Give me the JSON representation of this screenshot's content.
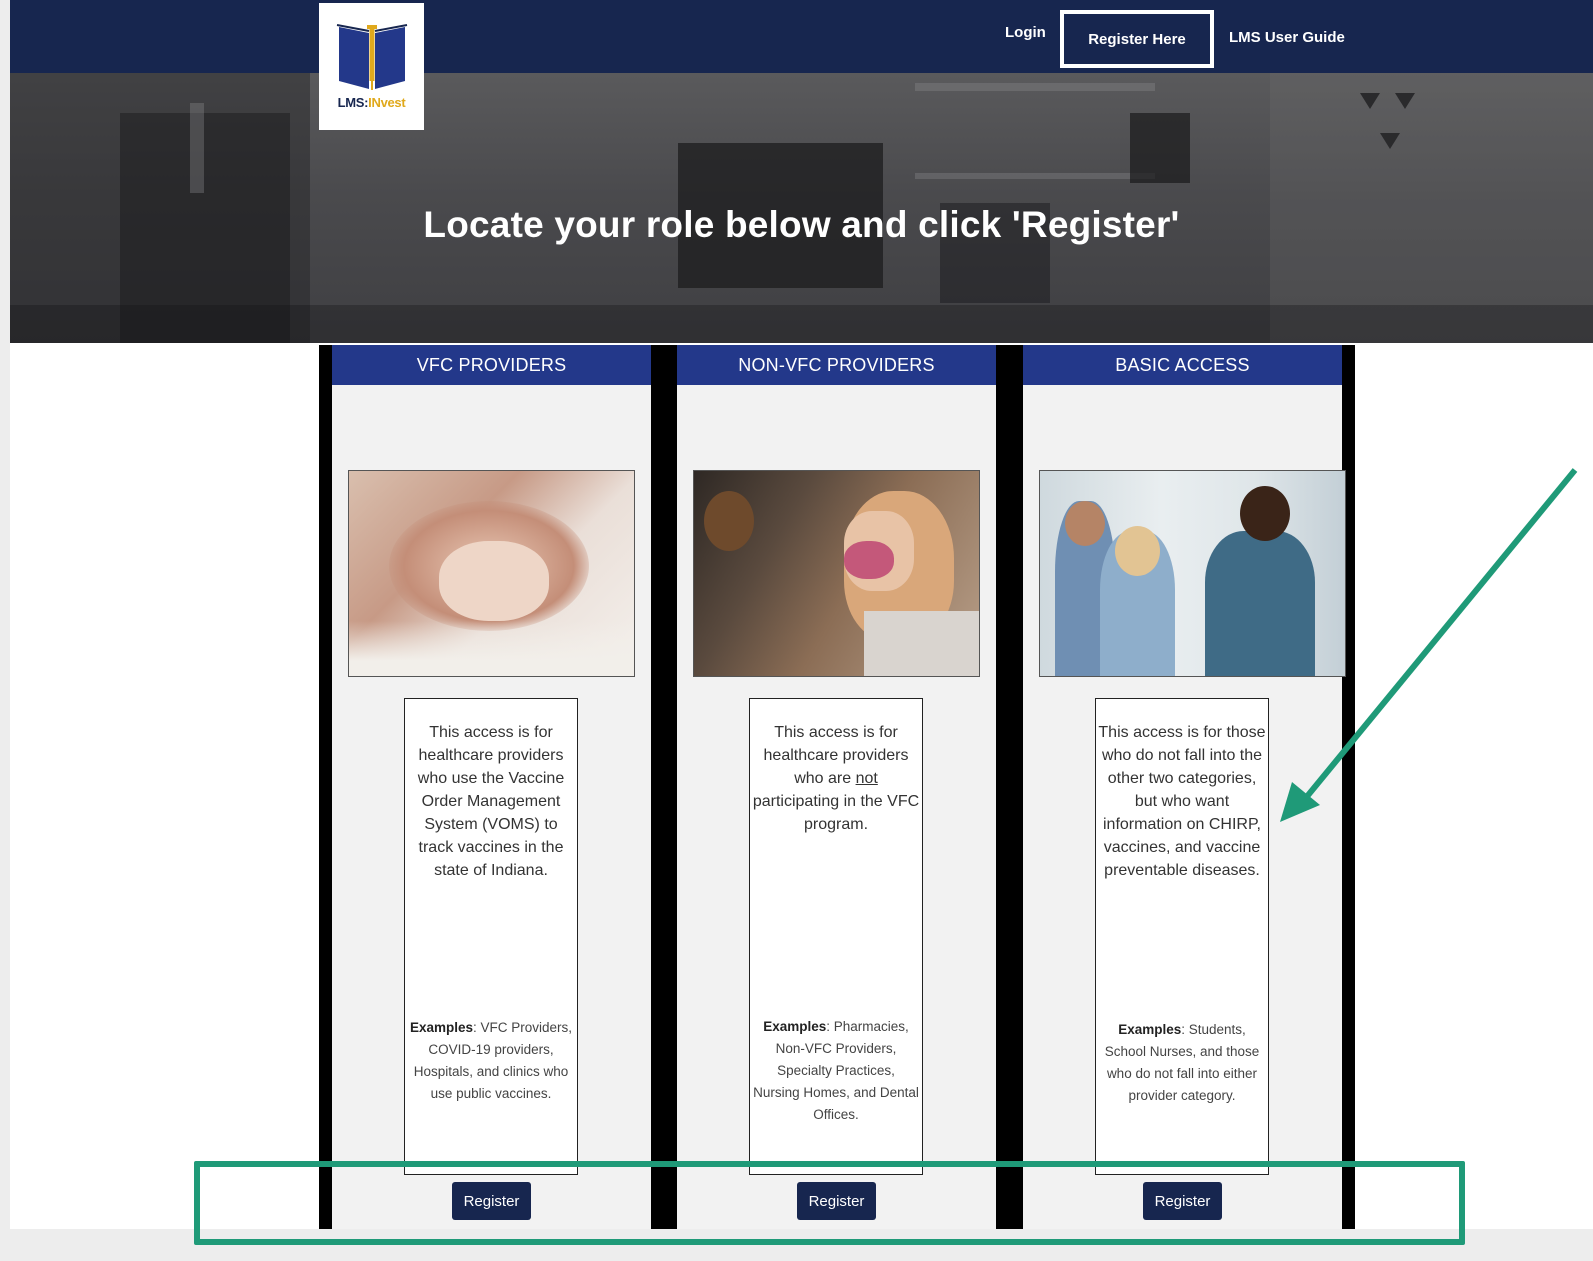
{
  "nav": {
    "login": "Login",
    "register_here": "Register Here",
    "user_guide": "LMS User Guide"
  },
  "logo": {
    "prefix": "LMS:",
    "suffix": "INvest"
  },
  "hero": {
    "title": "Locate your role below and click 'Register'"
  },
  "cards": [
    {
      "title": "VFC PROVIDERS",
      "description": "This access is for healthcare providers who use the Vaccine Order Management System (VOMS) to track vaccines in the state of Indiana.",
      "examples_label": "Examples",
      "examples_text": ": VFC Providers, COVID-19 providers, Hospitals, and clinics who use public vaccines.",
      "button": "Register"
    },
    {
      "title": "NON-VFC PROVIDERS",
      "description_pre": "This access is for healthcare providers who are",
      "description_underline": "not",
      "description_post": "participating in the VFC program.",
      "examples_label": "Examples",
      "examples_text": ": Pharmacies, Non-VFC Providers, Specialty Practices, Nursing Homes, and Dental Offices.",
      "button": "Register"
    },
    {
      "title": "BASIC ACCESS",
      "description": "This access is for those who do not fall into the other two categories, but who want information on CHIRP, vaccines, and vaccine preventable diseases.",
      "examples_label": "Examples",
      "examples_text": ": Students, School Nurses, and those who do not fall into either provider category.",
      "button": "Register"
    }
  ],
  "colors": {
    "nav_bg": "#17264f",
    "card_header": "#23388a",
    "annotation": "#1f9a78",
    "logo_accent": "#e0a91c"
  }
}
